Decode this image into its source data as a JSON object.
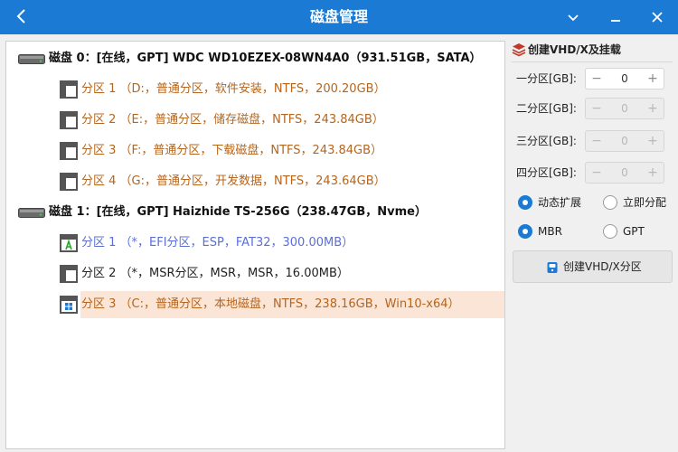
{
  "window": {
    "title": "磁盘管理"
  },
  "disks": [
    {
      "label": "磁盘 0：[在线，GPT] WDC WD10EZEX-08WN4A0（931.51GB，SATA）",
      "partitions": [
        {
          "label": "分区 1 （D:，普通分区，软件安装，NTFS，200.20GB）",
          "color": "#b5651d",
          "icon": "partition-icon"
        },
        {
          "label": "分区 2 （E:，普通分区，储存磁盘，NTFS，243.84GB）",
          "color": "#b5651d",
          "icon": "partition-icon"
        },
        {
          "label": "分区 3 （F:，普通分区，下载磁盘，NTFS，243.84GB）",
          "color": "#b5651d",
          "icon": "partition-icon"
        },
        {
          "label": "分区 4 （G:，普通分区，开发数据，NTFS，243.64GB）",
          "color": "#b5651d",
          "icon": "partition-icon"
        }
      ]
    },
    {
      "label": "磁盘 1：[在线，GPT] Haizhide TS-256G（238.47GB，Nvme）",
      "partitions": [
        {
          "label": "分区 1 （*，EFI分区，ESP，FAT32，300.00MB）",
          "color": "#5a6fd6",
          "icon": "efi-partition-icon"
        },
        {
          "label": "分区 2 （*，MSR分区，MSR，MSR，16.00MB）",
          "color": "#222222",
          "icon": "partition-icon"
        },
        {
          "label": "分区 3 （C:，普通分区，本地磁盘，NTFS，238.16GB，Win10-x64）",
          "color": "#b5651d",
          "icon": "windows-partition-icon",
          "selected": true
        }
      ]
    }
  ],
  "vhd_panel": {
    "title": "创建VHD/X及挂载",
    "partitions": [
      {
        "label": "一分区[GB]:",
        "value": "0",
        "enabled": true
      },
      {
        "label": "二分区[GB]:",
        "value": "0",
        "enabled": false
      },
      {
        "label": "三分区[GB]:",
        "value": "0",
        "enabled": false
      },
      {
        "label": "四分区[GB]:",
        "value": "0",
        "enabled": false
      }
    ],
    "minus": "−",
    "plus": "+",
    "alloc_dynamic": "动态扩展",
    "alloc_fixed": "立即分配",
    "style_mbr": "MBR",
    "style_gpt": "GPT",
    "create_button": "创建VHD/X分区"
  },
  "colors": {
    "accent": "#1a7ad4",
    "partition_text": "#b5651d",
    "efi_text": "#5a6fd6",
    "selected_bg": "#fbe5d6"
  }
}
